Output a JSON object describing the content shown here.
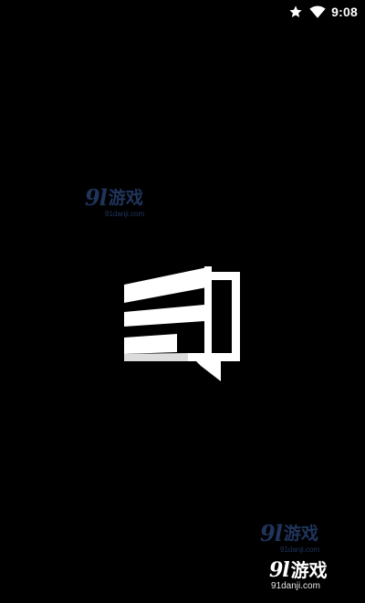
{
  "status_bar": {
    "time": "9:08",
    "icons": [
      "star-icon",
      "wifi-icon"
    ],
    "color": "#ffffff"
  },
  "splash": {
    "background": "#000000",
    "logo_icon": "chat-bubble-lines-icon",
    "logo_color": "#ffffff"
  },
  "watermarks": [
    {
      "number": "9l",
      "brand": "游戏",
      "url": "91danji.com",
      "color": "#3b5fa8"
    },
    {
      "number": "9l",
      "brand": "游戏",
      "url": "91danji.com",
      "color": "#3b5fa8"
    },
    {
      "number": "9l",
      "brand": "游戏",
      "url": "91danji.com",
      "color": "#ffffff"
    }
  ]
}
